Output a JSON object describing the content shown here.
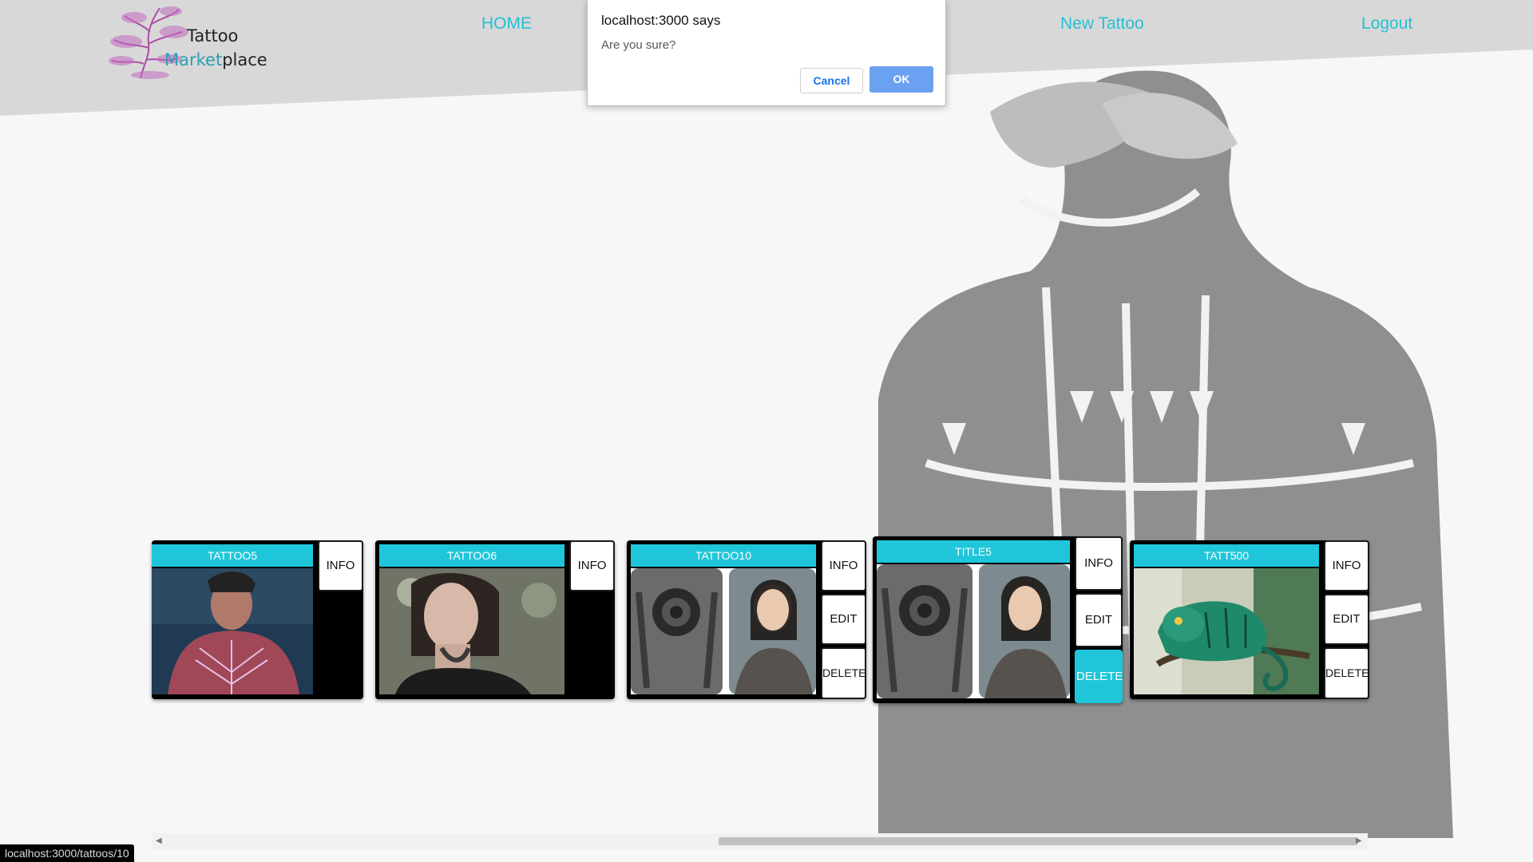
{
  "brand": {
    "line1": "Tattoo",
    "line2a": "Market",
    "line2b": "place"
  },
  "nav": {
    "home": "HOME",
    "new_tattoo": "New Tattoo",
    "logout": "Logout"
  },
  "dialog": {
    "title": "localhost:3000 says",
    "message": "Are you sure?",
    "cancel": "Cancel",
    "ok": "OK"
  },
  "cards": [
    {
      "title": "TATTOO5",
      "buttons": [
        "INFO"
      ]
    },
    {
      "title": "TATTOO6",
      "buttons": [
        "INFO"
      ]
    },
    {
      "title": "TATTOO10",
      "buttons": [
        "INFO",
        "EDIT",
        "DELETE"
      ]
    },
    {
      "title": "TITLE5",
      "buttons": [
        "INFO",
        "EDIT",
        "DELETE"
      ]
    },
    {
      "title": "TATT500",
      "buttons": [
        "INFO",
        "EDIT",
        "DELETE"
      ]
    }
  ],
  "status_url": "localhost:3000/tattoos/10",
  "colors": {
    "accent": "#1fc6da",
    "nav": "#26bfd3",
    "ok_button": "#6aa1f0"
  }
}
